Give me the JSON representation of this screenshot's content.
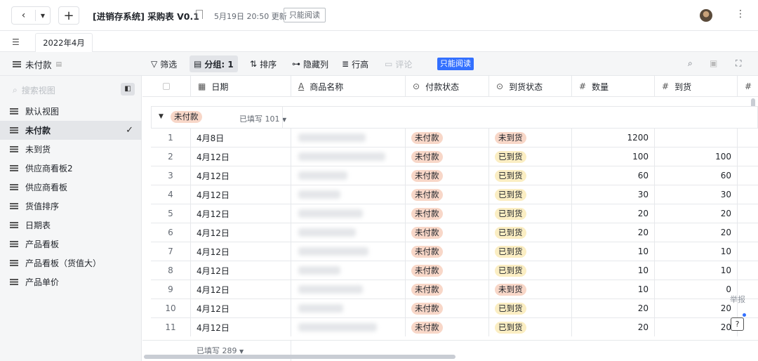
{
  "topbar": {
    "title": "[进销存系统] 采购表 V0.1",
    "updated": "5月19日 20:50 更新",
    "readonly": "只能阅读"
  },
  "tabs": [
    {
      "label": "2022年4月"
    }
  ],
  "toolbar": {
    "view_name": "未付款",
    "filter": "筛选",
    "group": "分组: 1",
    "sort": "排序",
    "hide_cols": "隐藏列",
    "row_height": "行高",
    "comment": "评论",
    "readonly_badge": "只能阅读"
  },
  "sidebar": {
    "search_placeholder": "搜索视图",
    "views": [
      {
        "label": "默认视图"
      },
      {
        "label": "未付款"
      },
      {
        "label": "未到货"
      },
      {
        "label": "供应商看板2"
      },
      {
        "label": "供应商看板"
      },
      {
        "label": "货值排序"
      },
      {
        "label": "日期表"
      },
      {
        "label": "产品看板"
      },
      {
        "label": "产品看板（货值大）"
      },
      {
        "label": "产品单价"
      }
    ]
  },
  "table": {
    "columns": [
      "日期",
      "商品名称",
      "付款状态",
      "到货状态",
      "数量",
      "到货",
      "#"
    ],
    "group": {
      "label": "未付款",
      "count": "已填写 101"
    },
    "rows": [
      {
        "n": "1",
        "date": "4月8日",
        "pay": "未付款",
        "arr": "未到货",
        "qty": "1200",
        "got": ""
      },
      {
        "n": "2",
        "date": "4月12日",
        "pay": "未付款",
        "arr": "已到货",
        "qty": "100",
        "got": "100"
      },
      {
        "n": "3",
        "date": "4月12日",
        "pay": "未付款",
        "arr": "已到货",
        "qty": "60",
        "got": "60"
      },
      {
        "n": "4",
        "date": "4月12日",
        "pay": "未付款",
        "arr": "已到货",
        "qty": "30",
        "got": "30"
      },
      {
        "n": "5",
        "date": "4月12日",
        "pay": "未付款",
        "arr": "已到货",
        "qty": "20",
        "got": "20"
      },
      {
        "n": "6",
        "date": "4月12日",
        "pay": "未付款",
        "arr": "已到货",
        "qty": "20",
        "got": "20"
      },
      {
        "n": "7",
        "date": "4月12日",
        "pay": "未付款",
        "arr": "已到货",
        "qty": "10",
        "got": "10"
      },
      {
        "n": "8",
        "date": "4月12日",
        "pay": "未付款",
        "arr": "已到货",
        "qty": "10",
        "got": "10"
      },
      {
        "n": "9",
        "date": "4月12日",
        "pay": "未付款",
        "arr": "未到货",
        "qty": "10",
        "got": "0"
      },
      {
        "n": "10",
        "date": "4月12日",
        "pay": "未付款",
        "arr": "已到货",
        "qty": "20",
        "got": "20"
      },
      {
        "n": "11",
        "date": "4月12日",
        "pay": "未付款",
        "arr": "已到货",
        "qty": "20",
        "got": "20"
      }
    ],
    "footer_count": "已填写 289"
  },
  "float": {
    "report": "举报"
  },
  "colors": {
    "unpaid_pill": "#f8d7c8",
    "arrival_pill": "#fbeec3",
    "accent": "#3370ff"
  }
}
